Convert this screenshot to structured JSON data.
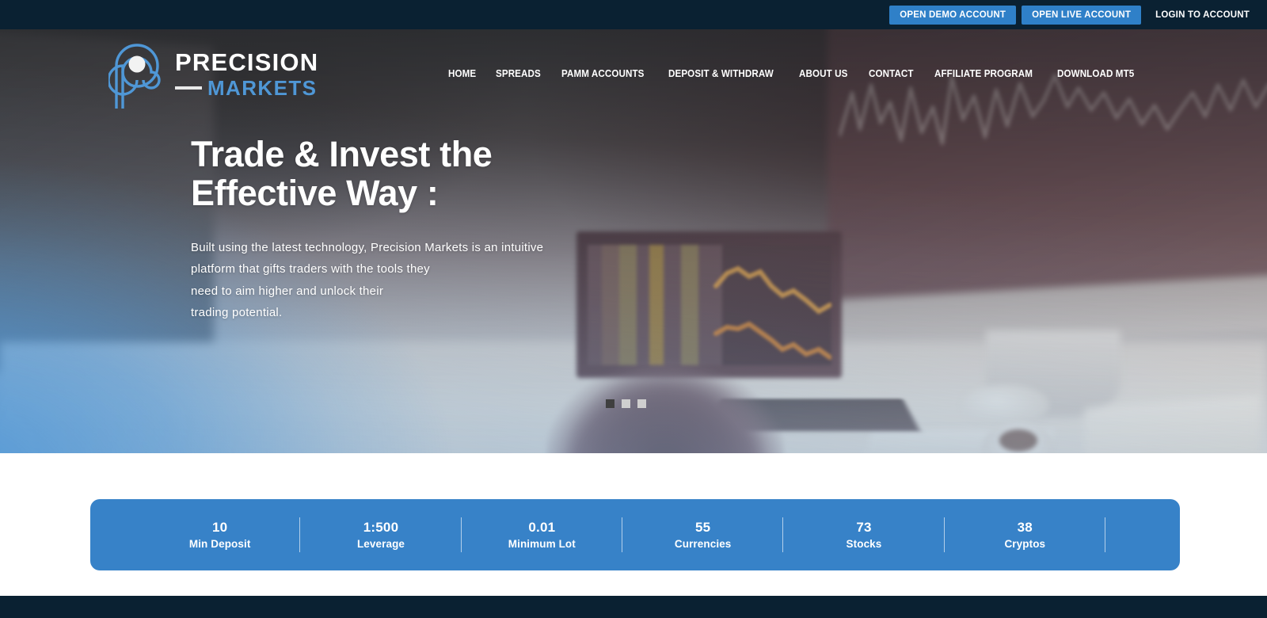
{
  "colors": {
    "brand_blue": "#3782c8",
    "top_button_blue": "#2f80c8",
    "dark_navy": "#0a2132",
    "logo_blue": "#4f97d6",
    "white": "#ffffff"
  },
  "topbar": {
    "demo_button": "OPEN DEMO ACCOUNT",
    "live_button": "OPEN LIVE ACCOUNT",
    "login_link": "LOGIN TO ACCOUNT"
  },
  "logo": {
    "mark": "spiral-p-logo-icon",
    "name_top": "PRECISION",
    "name_bottom": "MARKETS"
  },
  "nav": {
    "items": [
      {
        "label": "HOME"
      },
      {
        "label": "SPREADS"
      },
      {
        "label": "PAMM ACCOUNTS"
      },
      {
        "label": "DEPOSIT & WITHDRAW"
      },
      {
        "label": "ABOUT US"
      },
      {
        "label": "CONTACT"
      },
      {
        "label": "AFFILIATE PROGRAM"
      },
      {
        "label": "DOWNLOAD MT5"
      }
    ]
  },
  "hero": {
    "title": "Trade & Invest the\nEffective Way :",
    "subtitle": "Built using the latest technology, Precision Markets is an intuitive\nplatform that gifts traders with the tools they\nneed to aim higher and unlock their\ntrading potential.",
    "carousel": {
      "active_index": 0,
      "slide_count": 3
    }
  },
  "stats": {
    "items": [
      {
        "value": "10",
        "label": "Min Deposit"
      },
      {
        "value": "1:500",
        "label": "Leverage"
      },
      {
        "value": "0.01",
        "label": "Minimum Lot"
      },
      {
        "value": "55",
        "label": "Currencies"
      },
      {
        "value": "73",
        "label": "Stocks"
      },
      {
        "value": "38",
        "label": "Cryptos"
      }
    ]
  }
}
